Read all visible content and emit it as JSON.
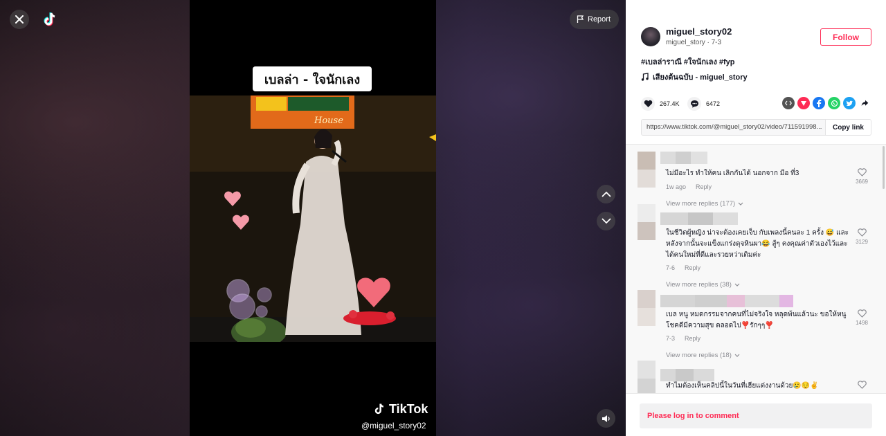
{
  "header": {
    "report_label": "Report"
  },
  "video": {
    "caption": "เบลล่า - ใจนักเลง",
    "watermark_brand": "TikTok",
    "watermark_user": "@miguel_story02",
    "sign_text": "House"
  },
  "author": {
    "username": "miguel_story02",
    "nickname": "miguel_story",
    "separator": " · ",
    "date": "7-3",
    "follow_label": "Follow"
  },
  "post": {
    "description": "#เบลล่าราณี #ใจนักเลง #fyp",
    "music": "เสียงต้นฉบับ - miguel_story",
    "likes": "267.4K",
    "comments": "6472",
    "link": "https://www.tiktok.com/@miguel_story02/video/711591998...",
    "copy_label": "Copy link"
  },
  "comments": [
    {
      "text": "ไม่มีอะไร ทำให้คน เลิกกันได้ นอกจาก มือ ที่3",
      "time": "1w ago",
      "reply_label": "Reply",
      "likes": "3669",
      "replies_label": "View more replies (177)"
    },
    {
      "text": "ในชีวิตผู้หญิง น่าจะต้องเคยเจ็บ กับเพลงนี้คนละ 1 ครั้ง 😅 และหลังจากนั้นจะแข็งแกร่งดุจหินผา😂 สู้ๆ คงคุณค่าตัวเองไว้และได้คนใหม่ที่ดีและรวยหว่าเดิมค่ะ",
      "time": "7-6",
      "reply_label": "Reply",
      "likes": "3129",
      "replies_label": "View more replies (38)"
    },
    {
      "text": "เบล หนู หมดกรรมจากคนที่ไม่จริงใจ หลุดพ้นแล้วนะ ขอให้หนู โชคดีมีความสุข ตลอดไป❣️รักๆๆ❣️",
      "time": "7-3",
      "reply_label": "Reply",
      "likes": "1498",
      "replies_label": "View more replies (18)"
    },
    {
      "text": "ทำไมต้องเห็นคลิปนี้ในวันที่เฮียแต่งงานด้วย🥲😌✌️",
      "time": "",
      "reply_label": "",
      "likes": "",
      "replies_label": ""
    }
  ],
  "login_prompt": "Please log in to comment",
  "colors": {
    "accent": "#fe2c55",
    "panel_bg": "#ffffff",
    "muted_text": "#8a8b91"
  },
  "icons": {
    "close": "close-icon",
    "logo": "tiktok-logo-icon",
    "report": "flag-icon",
    "up": "chevron-up-icon",
    "down": "chevron-down-icon",
    "volume": "volume-icon",
    "like": "heart-icon",
    "comment": "comment-bubble-icon",
    "music": "music-note-icon"
  }
}
